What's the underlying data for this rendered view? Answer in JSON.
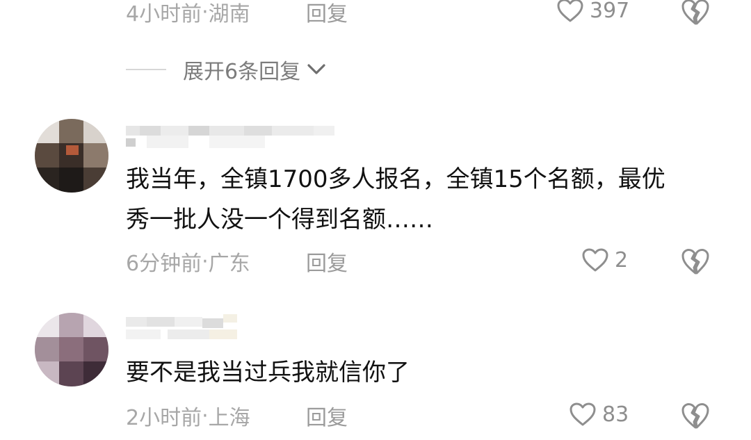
{
  "top_comment": {
    "time": "4小时前",
    "location": "湖南",
    "reply_label": "回复",
    "like_count": "397"
  },
  "expand_replies": {
    "label": "展开6条回复"
  },
  "comments": [
    {
      "text_line1": "我当年，全镇1700多人报名，全镇15个名额，最优",
      "text_line2": "秀一批人没一个得到名额……",
      "time": "6分钟前",
      "location": "广东",
      "reply_label": "回复",
      "like_count": "2"
    },
    {
      "text_line1": "要不是我当过兵我就信你了",
      "time": "2小时前",
      "location": "上海",
      "reply_label": "回复",
      "like_count": "83"
    }
  ],
  "meta_separator": " · ",
  "icons": {
    "like": "heart-outline-icon",
    "dislike": "broken-heart-icon",
    "expand": "chevron-down-icon"
  },
  "colors": {
    "meta_text": "#a7a7a7",
    "comment_text": "#111111",
    "icon_stroke": "#8e8e8e"
  }
}
